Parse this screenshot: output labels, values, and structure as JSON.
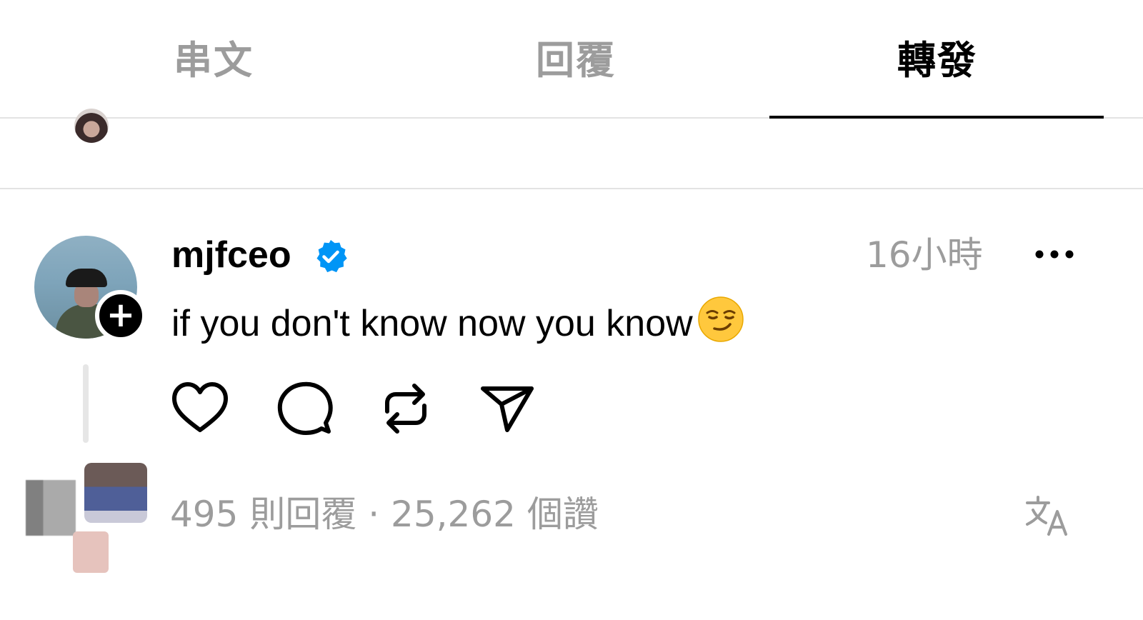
{
  "tabs": [
    {
      "label": "串文",
      "active": false
    },
    {
      "label": "回覆",
      "active": false
    },
    {
      "label": "轉發",
      "active": true
    }
  ],
  "post": {
    "username": "mjfceo",
    "verified": true,
    "time": "16小時",
    "text": "if you don't know now you know",
    "emoji": "smirking-face",
    "actions": [
      "heart-icon",
      "comment-icon",
      "repost-icon",
      "share-icon"
    ]
  },
  "footer": {
    "stats": "495 則回覆 · 25,262 個讚"
  },
  "colors": {
    "verified_blue": "#0095f6",
    "muted_text": "#9c9c9c",
    "divider": "#e3e3e3"
  }
}
